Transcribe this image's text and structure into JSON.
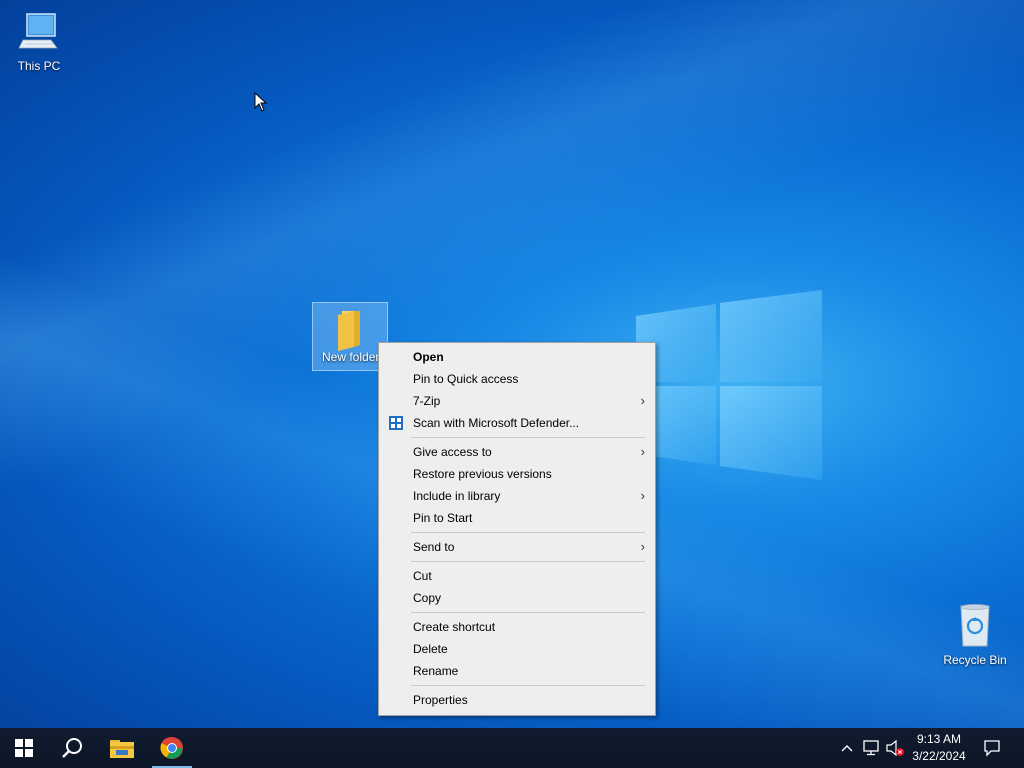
{
  "desktop": {
    "icons": [
      {
        "label": "This PC",
        "icon": "computer-icon"
      },
      {
        "label": "New folder",
        "icon": "folder-icon"
      },
      {
        "label": "Recycle Bin",
        "icon": "recycle-bin-icon"
      }
    ]
  },
  "context_menu": {
    "groups": [
      [
        {
          "label": "Open",
          "bold": true
        },
        {
          "label": "Pin to Quick access"
        },
        {
          "label": "7-Zip",
          "submenu": true
        },
        {
          "label": "Scan with Microsoft Defender...",
          "icon": "defender-shield-icon"
        }
      ],
      [
        {
          "label": "Give access to",
          "submenu": true
        },
        {
          "label": "Restore previous versions"
        },
        {
          "label": "Include in library",
          "submenu": true
        },
        {
          "label": "Pin to Start"
        }
      ],
      [
        {
          "label": "Send to",
          "submenu": true
        }
      ],
      [
        {
          "label": "Cut"
        },
        {
          "label": "Copy"
        }
      ],
      [
        {
          "label": "Create shortcut"
        },
        {
          "label": "Delete"
        },
        {
          "label": "Rename"
        }
      ],
      [
        {
          "label": "Properties"
        }
      ]
    ],
    "submenu_arrow": "›"
  },
  "taskbar": {
    "buttons": [
      "start-icon",
      "search-icon",
      "file-explorer-icon",
      "chrome-icon"
    ],
    "tray_icons": [
      "chevron-up-icon",
      "network-icon",
      "volume-muted-icon"
    ],
    "clock": {
      "time": "9:13 AM",
      "date": "3/22/2024"
    },
    "notification": "action-center-icon"
  },
  "colors": {
    "taskbar_bg": "#0f1a2e",
    "menu_bg": "#eeeeee",
    "wallpaper_accent": "#0a6fd4"
  }
}
